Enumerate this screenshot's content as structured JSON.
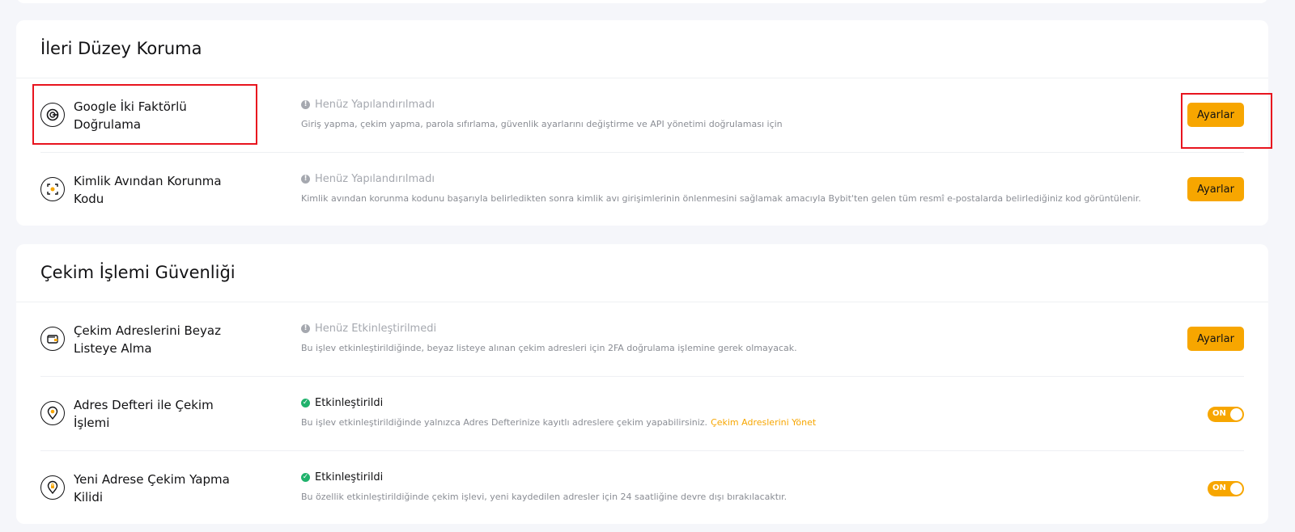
{
  "sections": [
    {
      "title": "İleri Düzey Koruma",
      "rows": [
        {
          "name": "Google İki Faktörlü Doğrulama",
          "status": "Henüz Yapılandırılmadı",
          "description": "Giriş yapma, çekim yapma, parola sıfırlama, güvenlik ayarlarını değiştirme ve API yönetimi doğrulaması için",
          "action": "Ayarlar"
        },
        {
          "name": "Kimlik Avından Korunma Kodu",
          "status": "Henüz Yapılandırılmadı",
          "description": "Kimlik avından korunma kodunu başarıyla belirledikten sonra kimlik avı girişimlerinin önlenmesini sağlamak amacıyla Bybit'ten gelen tüm resmî e-postalarda belirlediğiniz kod görüntülenir.",
          "action": "Ayarlar"
        }
      ]
    },
    {
      "title": "Çekim İşlemi Güvenliği",
      "rows": [
        {
          "name": "Çekim Adreslerini Beyaz Listeye Alma",
          "status": "Henüz Etkinleştirilmedi",
          "description": "Bu işlev etkinleştirildiğinde, beyaz listeye alınan çekim adresleri için 2FA doğrulama işlemine gerek olmayacak.",
          "action": "Ayarlar"
        },
        {
          "name": "Adres Defteri ile Çekim İşlemi",
          "status": "Etkinleştirildi",
          "description": "Bu işlev etkinleştirildiğinde yalnızca Adres Defterinize kayıtlı adreslere çekim yapabilirsiniz.",
          "link": "Çekim Adreslerini Yönet",
          "toggle": "ON"
        },
        {
          "name": "Yeni Adrese Çekim Yapma Kilidi",
          "status": "Etkinleştirildi",
          "description": "Bu özellik etkinleştirildiğinde çekim işlevi, yeni kaydedilen adresler için 24 saatliğine devre dışı bırakılacaktır.",
          "toggle": "ON"
        }
      ]
    }
  ],
  "icons": {
    "status_pending": "info-circle-icon",
    "status_enabled": "check-circle-icon"
  },
  "colors": {
    "accent": "#f7a600",
    "enabled": "#20b26c",
    "pending": "#a5a8af",
    "highlight": "#e8141e"
  }
}
